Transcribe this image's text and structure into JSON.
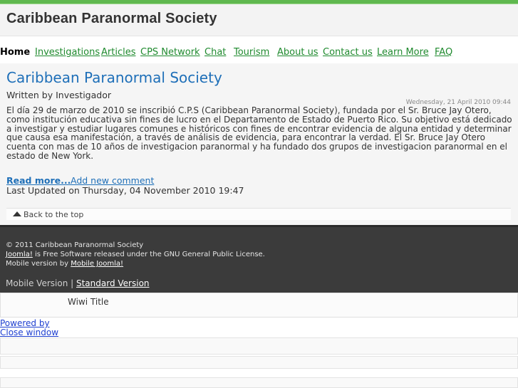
{
  "header": {
    "title": "Caribbean Paranormal Society"
  },
  "nav": {
    "items": [
      "Home",
      "Investigations",
      "Articles",
      "CPS Network",
      "Chat",
      "Tourism",
      "About us",
      "Contact us",
      "Learn More",
      "FAQ"
    ]
  },
  "article": {
    "title": "Caribbean Paranormal Society",
    "author": "Written by Investigador",
    "date": "Wednesday, 21 April 2010 09:44",
    "body": "El día 29 de marzo de 2010 se inscribió C.P.S (Caribbean Paranormal Society), fundada por el Sr. Bruce Jay Otero, como institución educativa sin fines de lucro en el Departamento de Estado de Puerto Rico. Su objetivo está dedicado a investigar y estudiar lugares comunes e históricos con fines de encontrar evidencia de alguna entidad y determinar que causa esa manifestación, a través de análisis de evidencia, para encontrar la verdad. El Sr. Bruce Jay Otero cuenta con mas de 10 años de investigacion paranormal y ha fundado dos grupos de investigacion paranormal en el estado de New York.",
    "read_more": "Read more...",
    "add_comment": "Add new comment",
    "last_updated": "Last Updated on Thursday, 04 November 2010 19:47",
    "back_to_top": "Back to the top"
  },
  "footer": {
    "copyright": "© 2011 Caribbean Paranormal Society",
    "joomla_link": "Joomla!",
    "license_text": " is Free Software released under the GNU General Public License.",
    "mobile_by": "Mobile version by ",
    "mobile_joomla_link": "Mobile Joomla!",
    "mobile_version": "Mobile Version | ",
    "standard_version": "Standard Version"
  },
  "popup": {
    "title": "Wiwi Title",
    "powered_by": "Powered by",
    "close_window": "Close window"
  },
  "colors": {
    "accent": "#5fb84f",
    "link": "#1e6fb8",
    "nav_link": "#1f8a2e",
    "footer_bg": "#3b3b3b"
  },
  "icons": {
    "back_to_top": "triangle-up-icon"
  }
}
